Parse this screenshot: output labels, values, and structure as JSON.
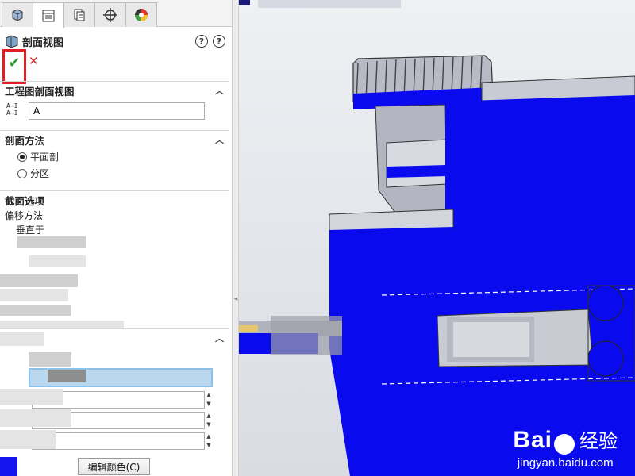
{
  "tabs": [
    {
      "icon": "feature-manager-icon",
      "active": false
    },
    {
      "icon": "property-manager-icon",
      "active": true
    },
    {
      "icon": "configuration-manager-icon",
      "active": false
    },
    {
      "icon": "dimxpert-icon",
      "active": false
    },
    {
      "icon": "display-manager-icon",
      "active": false
    }
  ],
  "panel": {
    "title": "剖面视图",
    "ok_icon": "checkmark-icon",
    "cancel_icon": "close-icon",
    "sections": {
      "drawing_section_view": {
        "title": "工程图剖面视图",
        "name_value": "A"
      },
      "section_method": {
        "title": "剖面方法",
        "options": [
          "平面剖",
          "分区"
        ],
        "selected": "平面剖"
      },
      "cut_options": {
        "title": "截面选项",
        "offset_method": "偏移方法",
        "normal_to": "垂直于"
      }
    },
    "edit_color_button": "编辑颜色(C)"
  },
  "watermark": {
    "brand_left": "Bai",
    "brand_right": "经验",
    "site": "jingyan.baidu.com"
  },
  "colors": {
    "section_fill": "#0a0aef",
    "ok_highlight": "#e02020",
    "ok_check": "#2f9e2f",
    "cancel": "#d02020"
  }
}
